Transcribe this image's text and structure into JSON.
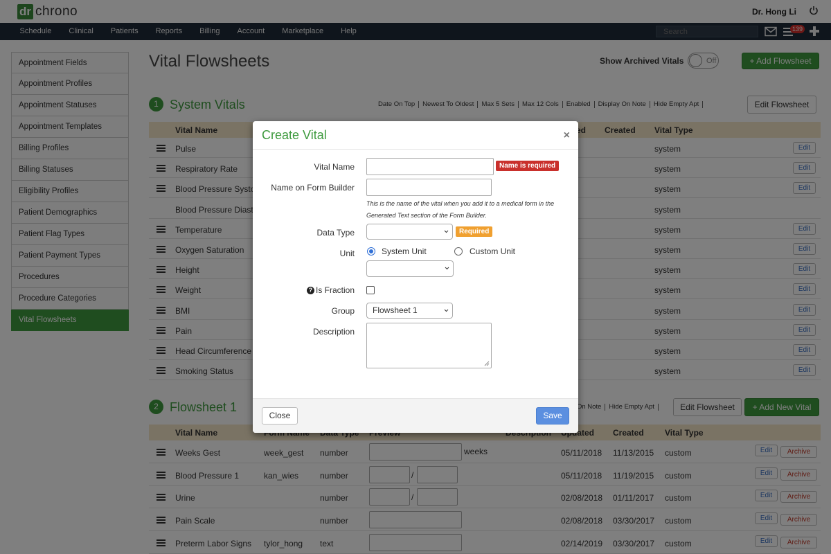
{
  "header": {
    "logo_mark": "dr",
    "logo_text": "chrono",
    "user_name": "Dr. Hong Li",
    "nav": [
      "Schedule",
      "Clinical",
      "Patients",
      "Reports",
      "Billing",
      "Account",
      "Marketplace",
      "Help"
    ],
    "search_placeholder": "Search",
    "notification_count": "139"
  },
  "sidebar": {
    "items": [
      "Appointment Fields",
      "Appointment Profiles",
      "Appointment Statuses",
      "Appointment Templates",
      "Billing Profiles",
      "Billing Statuses",
      "Eligibility Profiles",
      "Patient Demographics",
      "Patient Flag Types",
      "Patient Payment Types",
      "Procedures",
      "Procedure Categories",
      "Vital Flowsheets"
    ],
    "active": "Vital Flowsheets"
  },
  "main": {
    "title": "Vital Flowsheets",
    "show_archived_label": "Show Archived Vitals",
    "toggle_state": "Off",
    "add_flowsheet_label": "+ Add Flowsheet",
    "system_section": {
      "number": "1",
      "title": "System Vitals",
      "flags": [
        "Date On Top",
        "Newest To Oldest",
        "Max 5 Sets",
        "Max 12 Cols",
        "Enabled",
        "Display On Note",
        "Hide Empty Apt"
      ],
      "edit_label": "Edit Flowsheet",
      "columns": {
        "name": "Vital Name",
        "updated": "ed",
        "created": "Created",
        "type": "Vital Type"
      },
      "rows": [
        {
          "name": "Pulse",
          "type": "system",
          "draggable": true,
          "editable": true
        },
        {
          "name": "Respiratory Rate",
          "type": "system",
          "draggable": true,
          "editable": true
        },
        {
          "name": "Blood Pressure Systo",
          "type": "system",
          "draggable": true,
          "editable": true
        },
        {
          "name": "Blood Pressure Diasto",
          "type": "system",
          "draggable": false,
          "editable": false
        },
        {
          "name": "Temperature",
          "type": "system",
          "draggable": true,
          "editable": true
        },
        {
          "name": "Oxygen Saturation",
          "type": "system",
          "draggable": true,
          "editable": true
        },
        {
          "name": "Height",
          "type": "system",
          "draggable": true,
          "editable": true
        },
        {
          "name": "Weight",
          "type": "system",
          "draggable": true,
          "editable": true
        },
        {
          "name": "BMI",
          "type": "system",
          "draggable": true,
          "editable": true
        },
        {
          "name": "Pain",
          "type": "system",
          "draggable": true,
          "editable": true
        },
        {
          "name": "Head Circumference",
          "type": "system",
          "draggable": true,
          "editable": true
        },
        {
          "name": "Smoking Status",
          "type": "system",
          "draggable": true,
          "editable": true
        }
      ],
      "edit_button": "Edit"
    },
    "flowsheet1_section": {
      "number": "2",
      "title": "Flowsheet 1",
      "flags": [
        "On Note",
        "Hide Empty Apt"
      ],
      "edit_label": "Edit Flowsheet",
      "add_vital_label": "+ Add New Vital",
      "columns": {
        "name": "Vital Name",
        "form_name": "Form Name",
        "data_type": "Data Type",
        "preview": "Preview",
        "description": "Description",
        "updated": "Updated",
        "created": "Created",
        "type": "Vital Type"
      },
      "rows": [
        {
          "name": "Weeks Gest",
          "form_name": "week_gest",
          "data_type": "number",
          "preview_suffix": "weeks",
          "fraction": false,
          "updated": "05/11/2018",
          "created": "11/13/2015",
          "type": "custom"
        },
        {
          "name": "Blood Pressure 1",
          "form_name": "kan_wies",
          "data_type": "number",
          "preview_suffix": "",
          "fraction": true,
          "updated": "05/11/2018",
          "created": "11/19/2015",
          "type": "custom"
        },
        {
          "name": "Urine",
          "form_name": "",
          "data_type": "number",
          "preview_suffix": "",
          "fraction": true,
          "updated": "02/08/2018",
          "created": "01/11/2017",
          "type": "custom"
        },
        {
          "name": "Pain Scale",
          "form_name": "",
          "data_type": "number",
          "preview_suffix": "",
          "fraction": false,
          "updated": "02/08/2018",
          "created": "03/30/2017",
          "type": "custom"
        },
        {
          "name": "Preterm Labor Signs",
          "form_name": "tylor_hong",
          "data_type": "text",
          "preview_suffix": "",
          "fraction": false,
          "updated": "02/14/2019",
          "created": "03/30/2017",
          "type": "custom"
        }
      ],
      "fraction_separator": "/",
      "edit_button": "Edit",
      "archive_button": "Archive"
    }
  },
  "modal": {
    "title": "Create Vital",
    "close_x": "×",
    "vital_name_label": "Vital Name",
    "vital_name_value": "",
    "vital_name_error": "Name is required",
    "form_name_label": "Name on Form Builder",
    "form_name_value": "",
    "form_name_help": "This is the name of the vital when you add it to a medical form in the Generated Text section of the Form Builder.",
    "data_type_label": "Data Type",
    "data_type_value": "",
    "data_type_badge": "Required",
    "unit_label": "Unit",
    "unit_option_system": "System Unit",
    "unit_option_custom": "Custom Unit",
    "unit_value": "",
    "fraction_label": "Is Fraction",
    "help_glyph": "?",
    "group_label": "Group",
    "group_value": "Flowsheet 1",
    "description_label": "Description",
    "description_value": "",
    "close_button": "Close",
    "save_button": "Save"
  },
  "colors": {
    "brand_green": "#3e9a3e",
    "nav_dark": "#1e2a38",
    "error_red": "#c9302c",
    "warning_orange": "#f0a030",
    "primary_blue": "#5b8fe0"
  }
}
